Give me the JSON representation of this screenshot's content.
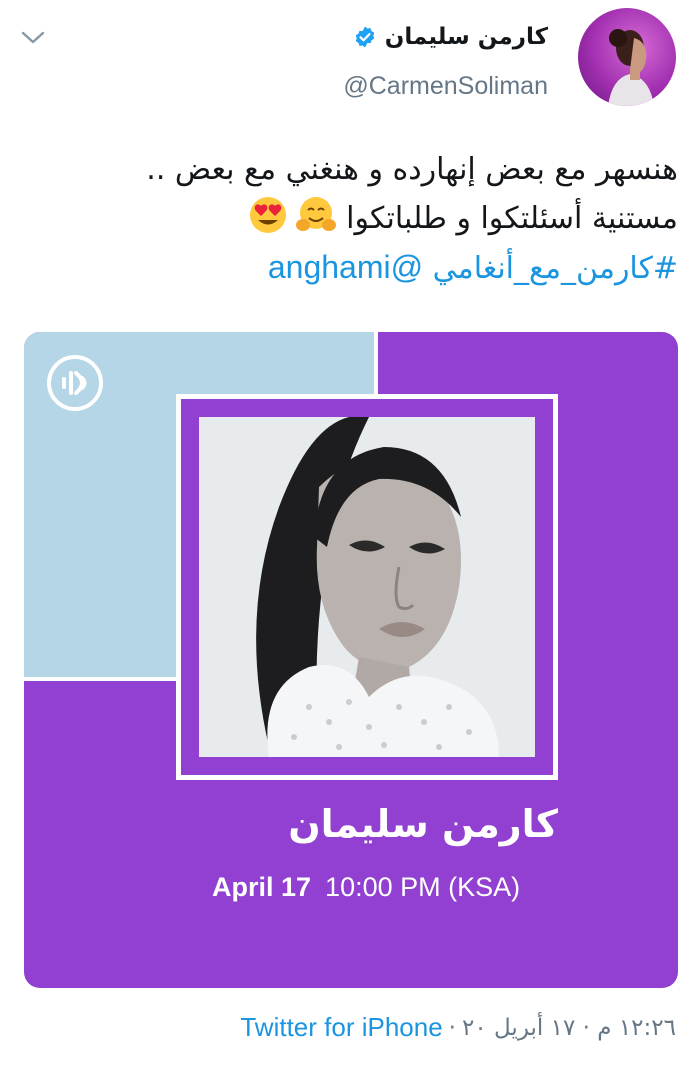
{
  "author": {
    "display_name": "كارمن سليمان",
    "handle": "@CarmenSoliman",
    "verified": true
  },
  "tweet": {
    "line1": "هنسهر مع بعض إنهارده و هنغني مع بعض ..",
    "line2": "مستنية أسئلتكوا و طلباتكوا",
    "line2_emojis": [
      "hugging-face",
      "heart-eyes-face"
    ],
    "hashtag": "#كارمن_مع_أنغامي",
    "mention": "@anghami"
  },
  "media": {
    "artist_name": "كارمن سليمان",
    "date": "April 17",
    "time": "10:00 PM (KSA)",
    "logo_icon": "anghami-logo-icon"
  },
  "footer": {
    "timestamp": "١٢:٢٦ م · ١٧ أبريل ٢٠",
    "separator": "·",
    "source": "Twitter for iPhone"
  },
  "colors": {
    "link": "#1b95e0",
    "card_purple": "#9140d1",
    "card_blue": "#b4d6e6",
    "text_secondary": "#657786"
  }
}
